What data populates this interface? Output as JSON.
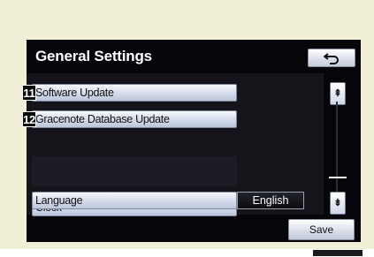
{
  "header": {
    "title": "General Settings",
    "back_icon": "return-arrow-icon"
  },
  "items": [
    {
      "label": "Software Update",
      "number": "11"
    },
    {
      "label": "Gracenote Database Update",
      "number": "12"
    },
    {
      "label": "Clock"
    },
    {
      "label": "Language",
      "value": "English"
    }
  ],
  "scroll": {
    "up_icon": "scroll-up-icon",
    "down_icon": "scroll-down-icon"
  },
  "footer": {
    "save_label": "Save"
  },
  "colors": {
    "screen_bg": "#06060a",
    "frame_bg": "#f1f0d6",
    "button_face": "#d3daea"
  }
}
